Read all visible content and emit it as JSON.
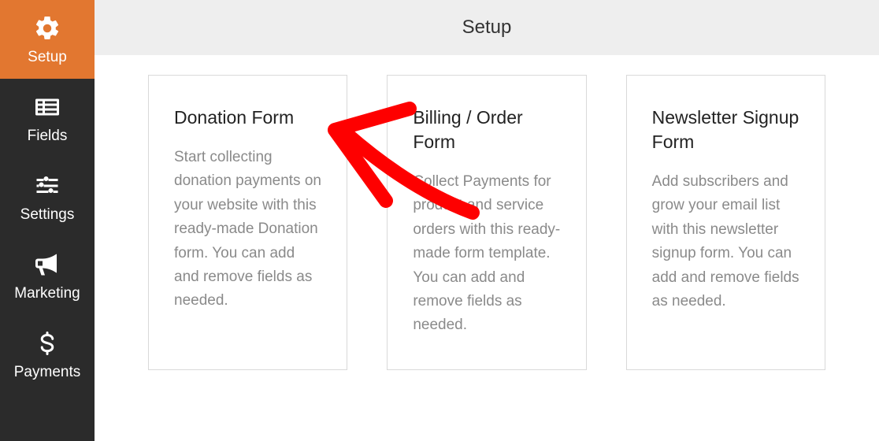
{
  "header": {
    "title": "Setup"
  },
  "sidebar": {
    "items": [
      {
        "label": "Setup"
      },
      {
        "label": "Fields"
      },
      {
        "label": "Settings"
      },
      {
        "label": "Marketing"
      },
      {
        "label": "Payments"
      }
    ]
  },
  "cards": [
    {
      "title": "Donation Form",
      "description": "Start collecting donation payments on your website with this ready-made Donation form. You can add and remove fields as needed."
    },
    {
      "title": "Billing / Order Form",
      "description": "Collect Payments for product and service orders with this ready-made form template. You can add and remove fields as needed."
    },
    {
      "title": "Newsletter Signup Form",
      "description": "Add subscribers and grow your email list with this newsletter signup form. You can add and remove fields as needed."
    }
  ],
  "annotation": {
    "arrow_color": "#fe0000"
  }
}
